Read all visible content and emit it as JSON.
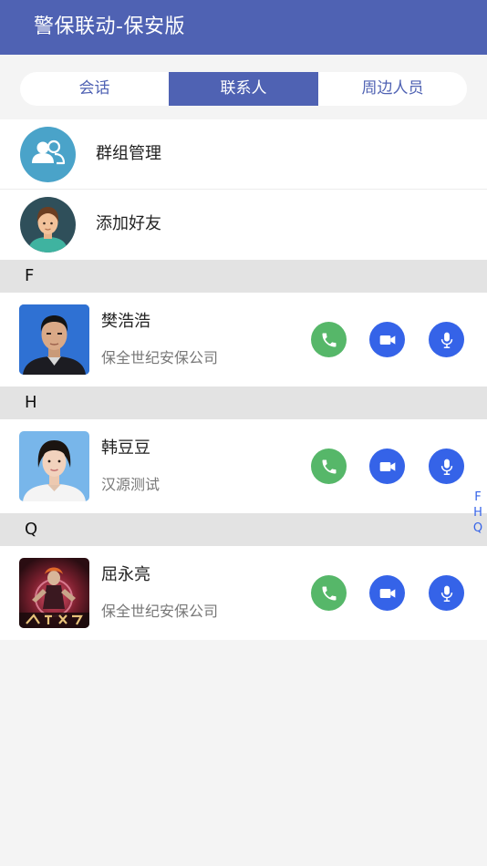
{
  "header": {
    "title": "警保联动-保安版"
  },
  "tabs": [
    {
      "label": "会话",
      "active": false
    },
    {
      "label": "联系人",
      "active": true
    },
    {
      "label": "周边人员",
      "active": false
    }
  ],
  "actions": [
    {
      "label": "群组管理",
      "icon": "group-icon"
    },
    {
      "label": "添加好友",
      "icon": "add-friend-avatar-icon"
    }
  ],
  "sections": [
    {
      "letter": "F",
      "contacts": [
        {
          "name": "樊浩浩",
          "org": "保全世纪安保公司",
          "photo": "avatar-man"
        }
      ]
    },
    {
      "letter": "H",
      "contacts": [
        {
          "name": "韩豆豆",
          "org": "汉源测试",
          "photo": "avatar-woman"
        }
      ]
    },
    {
      "letter": "Q",
      "contacts": [
        {
          "name": "屈永亮",
          "org": "保全世纪安保公司",
          "photo": "avatar-game-art"
        }
      ]
    }
  ],
  "index_letters": [
    "F",
    "H",
    "Q"
  ],
  "colors": {
    "brand": "#4f62b3",
    "phone_green": "#56b769",
    "action_blue": "#3563e8",
    "section_bg": "#e3e3e3"
  }
}
